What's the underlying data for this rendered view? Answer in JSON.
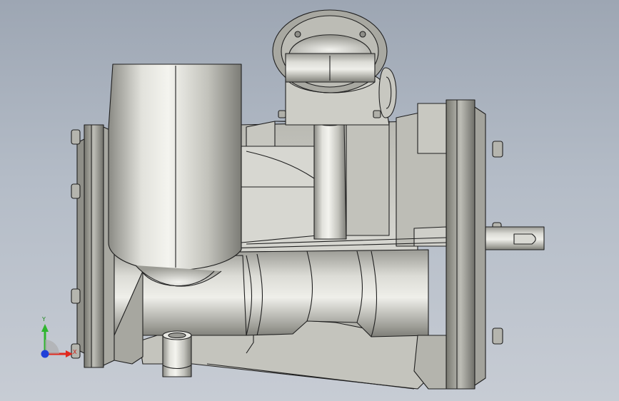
{
  "window": {
    "kind": "cad-3d-viewport",
    "background_top": "#9da6b3",
    "background_bottom": "#c7ccd4"
  },
  "model": {
    "subject": "pump-assembly",
    "shade": "#c9c9c1",
    "edge": "#1f1f1f"
  },
  "triad": {
    "x_label": "X",
    "y_label": "Y",
    "x_color": "#e0281e",
    "y_color": "#2fb52f",
    "z_color": "#1f3fd8"
  }
}
